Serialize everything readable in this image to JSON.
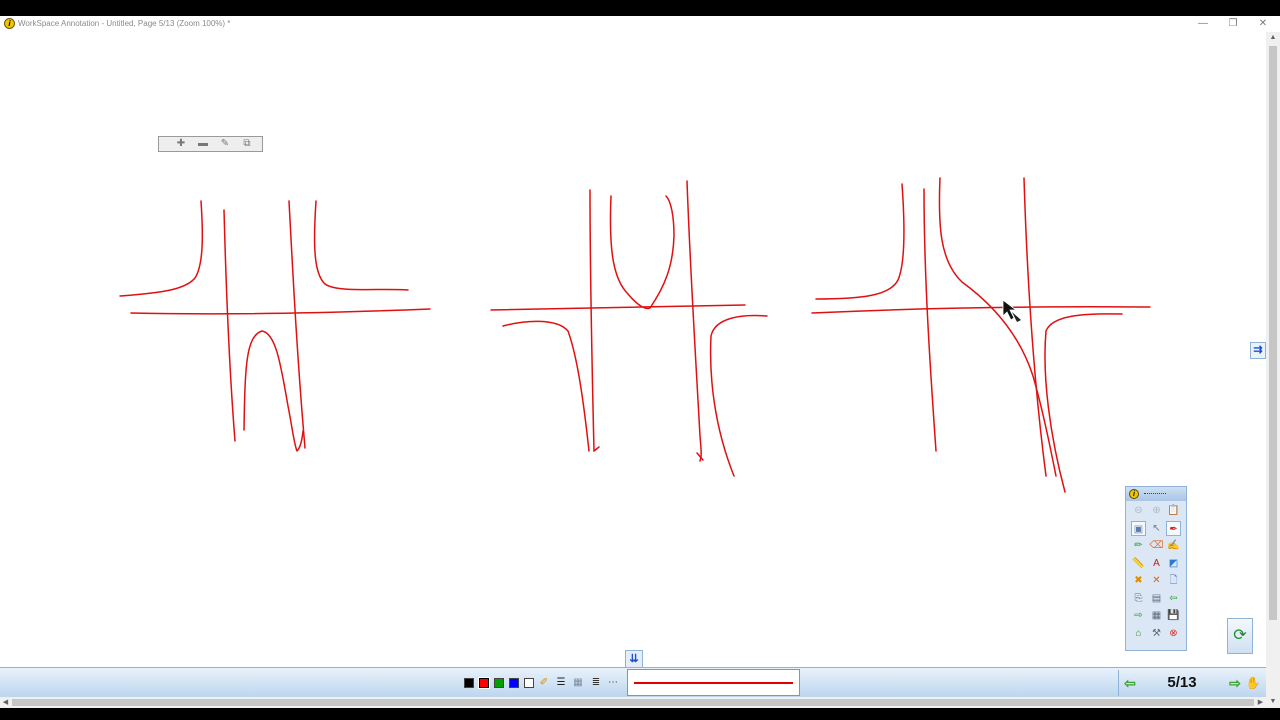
{
  "window": {
    "title": "WorkSpace Annotation - Untitled, Page 5/13  (Zoom 100%) *",
    "app_icon_letter": "i",
    "controls": {
      "minimize": "—",
      "maximize": "❐",
      "close": "✕"
    }
  },
  "zoom_toolbar": {
    "buttons": [
      {
        "name": "zoom-in-icon",
        "glyph": "✚"
      },
      {
        "name": "zoom-out-icon",
        "glyph": "▬"
      },
      {
        "name": "edit-icon",
        "glyph": "✎"
      },
      {
        "name": "copy-page-icon",
        "glyph": "⧉"
      }
    ]
  },
  "bottom_toolbar": {
    "expand_glyph": "⇊",
    "colors": [
      "#000000",
      "#ff0000",
      "#00a000",
      "#0000ff",
      "#ffffff"
    ],
    "tool_icons": [
      {
        "name": "highlighter-icon",
        "glyph": "✐",
        "color": "#e08a00"
      },
      {
        "name": "line-width-icon",
        "glyph": "☰",
        "color": "#222222"
      },
      {
        "name": "transparency-icon",
        "glyph": "▦",
        "color": "#7a8aa0"
      },
      {
        "name": "line-style-icon",
        "glyph": "≣",
        "color": "#333333"
      },
      {
        "name": "dash-style-icon",
        "glyph": "⋯",
        "color": "#333333"
      }
    ],
    "pen_color": "#e00000",
    "page_indicator": "5/13",
    "prev_glyph": "⇦",
    "next_glyph": "⇨",
    "extra_glyph": "✋"
  },
  "side_tab_glyph": "⇉",
  "refresh_glyph": "⟳",
  "palette": {
    "logo_letter": "i",
    "tools": [
      {
        "name": "minimize-palette-icon",
        "glyph": "⊖",
        "color": "#b0b8c4"
      },
      {
        "name": "maximize-palette-icon",
        "glyph": "⊕",
        "color": "#b0b8c4"
      },
      {
        "name": "clipboard-icon",
        "glyph": "📋",
        "color": "#8090a0"
      },
      {
        "name": "desktop-mode-icon",
        "glyph": "▣",
        "color": "#5a7ab0"
      },
      {
        "name": "select-arrow-icon",
        "glyph": "↖",
        "color": "#6a7a8a"
      },
      {
        "name": "pen-tool-icon",
        "glyph": "✒",
        "color": "#d02020"
      },
      {
        "name": "pen-icon",
        "glyph": "✏",
        "color": "#2a9a2a"
      },
      {
        "name": "eraser-icon",
        "glyph": "⌫",
        "color": "#e07030"
      },
      {
        "name": "highlight-pen-icon",
        "glyph": "✍",
        "color": "#e08a00"
      },
      {
        "name": "ruler-icon",
        "glyph": "📏",
        "color": "#445566"
      },
      {
        "name": "text-tool-icon",
        "glyph": "A",
        "color": "#c02020"
      },
      {
        "name": "shapes-icon",
        "glyph": "◩",
        "color": "#2a7ad0"
      },
      {
        "name": "clear-icon",
        "glyph": "✖",
        "color": "#e08a00"
      },
      {
        "name": "delete-icon",
        "glyph": "✕",
        "color": "#e06010"
      },
      {
        "name": "new-page-icon",
        "glyph": "🗋",
        "color": "#4a7ac0"
      },
      {
        "name": "capture-icon",
        "glyph": "⎘",
        "color": "#5a6a7a"
      },
      {
        "name": "screen-shade-icon",
        "glyph": "▤",
        "color": "#5a6a7a"
      },
      {
        "name": "previous-page-icon",
        "glyph": "⇦",
        "color": "#2a9a2a"
      },
      {
        "name": "next-page-icon",
        "glyph": "⇨",
        "color": "#2a9a2a"
      },
      {
        "name": "table-icon",
        "glyph": "▦",
        "color": "#5a6a7a"
      },
      {
        "name": "save-icon",
        "glyph": "💾",
        "color": "#334455"
      },
      {
        "name": "gallery-icon",
        "glyph": "⌂",
        "color": "#2a9a2a"
      },
      {
        "name": "tools-icon",
        "glyph": "⚒",
        "color": "#5a6a7a"
      },
      {
        "name": "exit-icon",
        "glyph": "⊗",
        "color": "#e03020"
      }
    ]
  }
}
